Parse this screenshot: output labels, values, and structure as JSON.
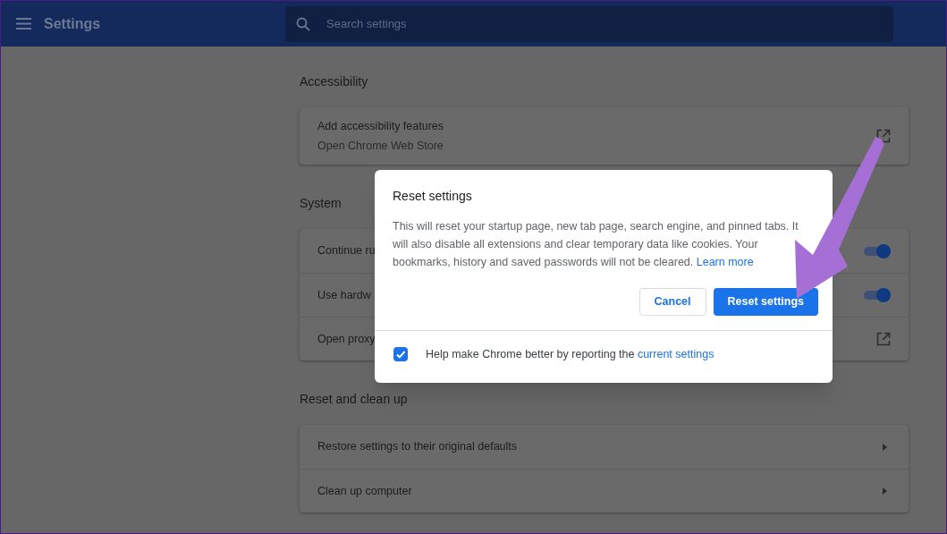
{
  "header": {
    "title": "Settings",
    "search": {
      "placeholder": "Search settings"
    }
  },
  "sections": [
    {
      "title": "Accessibility",
      "rows": [
        {
          "kind": "link",
          "label": "Add accessibility features",
          "sublabel": "Open Chrome Web Store"
        }
      ]
    },
    {
      "title": "System",
      "rows": [
        {
          "kind": "toggle",
          "label": "Continue ru",
          "on": true
        },
        {
          "kind": "toggle",
          "label": "Use hardw",
          "on": true
        },
        {
          "kind": "link",
          "label": "Open proxy"
        }
      ]
    },
    {
      "title": "Reset and clean up",
      "rows": [
        {
          "kind": "arrow",
          "label": "Restore settings to their original defaults"
        },
        {
          "kind": "arrow",
          "label": "Clean up computer"
        }
      ]
    }
  ],
  "dialog": {
    "title": "Reset settings",
    "body": "This will reset your startup page, new tab page, search engine, and pinned tabs. It will also disable all extensions and clear temporary data like cookies. Your bookmarks, history and saved passwords will not be cleared.",
    "link": "Learn more",
    "buttons": [
      {
        "kind": "secondary",
        "label": "Cancel"
      },
      {
        "kind": "primary",
        "label": "Reset settings"
      }
    ],
    "footer": {
      "checked": true,
      "text": "Help make Chrome better by reporting the",
      "link": "current settings"
    }
  }
}
